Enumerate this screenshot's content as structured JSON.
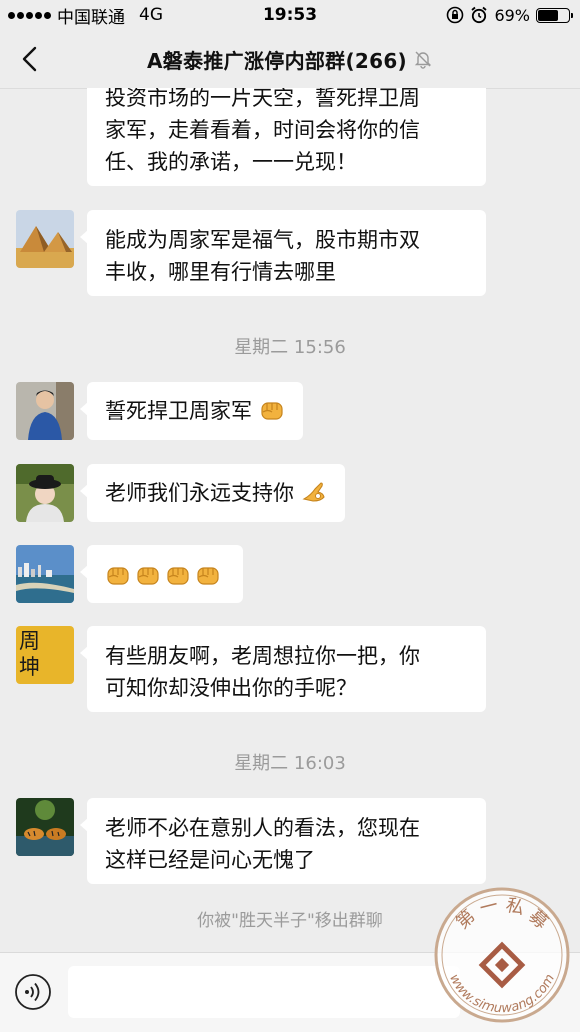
{
  "status_bar": {
    "carrier": "中国联通",
    "network": "4G",
    "time": "19:53",
    "battery_text": "69%",
    "battery_level": 0.69
  },
  "header": {
    "title": "A磐泰推广涨停内部群(266)",
    "icons": {
      "back": "chevron-left-icon",
      "mute": "mute-bell-icon"
    }
  },
  "messages": [
    {
      "lines": [
        "投资市场的一片天空，誓死捍卫周",
        "家军，走着看着，时间会将你的信",
        "任、我的承诺，一一兑现！"
      ],
      "avatar": "none"
    },
    {
      "lines": [
        "能成为周家军是福气，股市期市双",
        "丰收，哪里有行情去哪里"
      ],
      "avatar": "pyramids-avatar"
    },
    {
      "lines": [
        "誓死捍卫周家军"
      ],
      "emoji": "fist-emoji",
      "avatar": "man-blue-jacket-avatar"
    },
    {
      "lines": [
        "老师我们永远支持你"
      ],
      "emoji": "ok-hand-emoji",
      "avatar": "woman-hat-avatar"
    },
    {
      "lines": [],
      "emoji": "fist-emoji",
      "emoji_count": 4,
      "avatar": "cityscape-avatar"
    },
    {
      "lines": [
        "有些朋友啊，老周想拉你一把，你",
        "可知你却没伸出你的手呢？"
      ],
      "avatar": "calligraphy-avatar",
      "avatar_text": "周坤"
    },
    {
      "lines": [
        "老师不必在意别人的看法，您现在",
        "这样已经是问心无愧了"
      ],
      "avatar": "tiger-avatar"
    }
  ],
  "time_separators": [
    "星期二 15:56",
    "星期二 16:03"
  ],
  "system_message": "你被\"胜天半子\"移出群聊",
  "input_bar": {
    "icons": {
      "voice": "voice-icon"
    }
  },
  "watermark": {
    "text": "第 一 私 募",
    "url_text": "www.simuwang.com",
    "color": "#c9a98f"
  }
}
